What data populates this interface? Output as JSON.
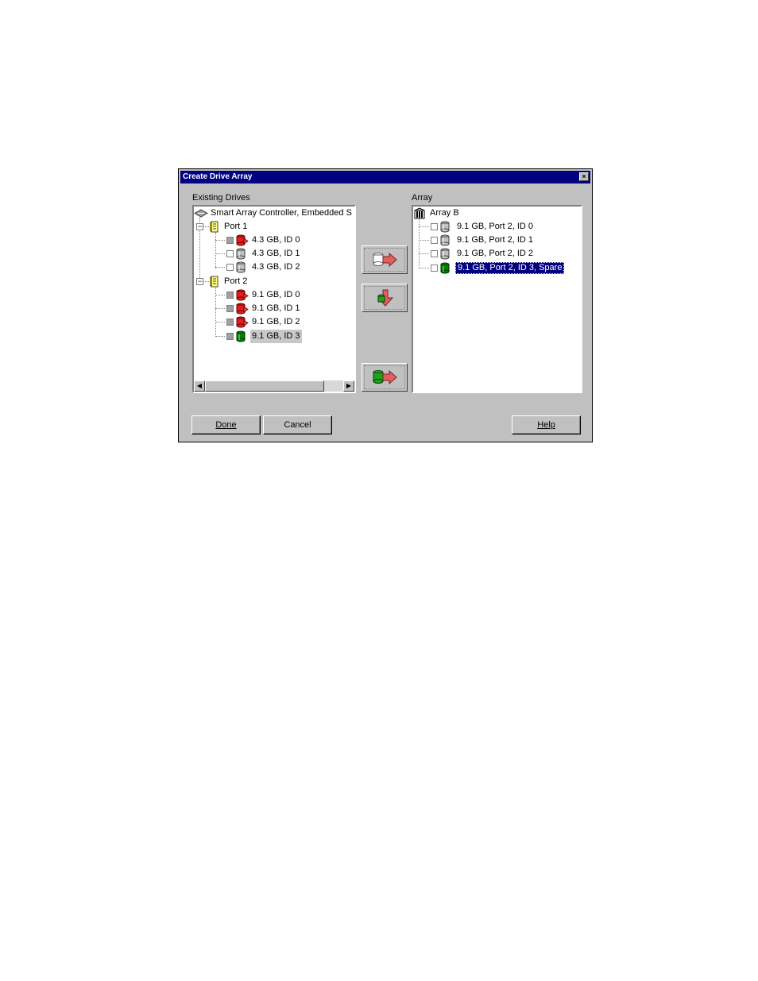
{
  "window": {
    "title": "Create Drive Array",
    "close_label": "×"
  },
  "existing": {
    "label": "Existing Drives",
    "controller": "Smart Array Controller, Embedded S",
    "ports": [
      {
        "label": "Port 1",
        "drives": [
          "4.3 GB, ID 0",
          "4.3 GB, ID 1",
          "4.3 GB, ID 2"
        ]
      },
      {
        "label": "Port 2",
        "drives": [
          "9.1 GB, ID 0",
          "9.1 GB, ID 1",
          "9.1 GB, ID 2",
          "9.1 GB, ID 3"
        ]
      }
    ]
  },
  "array": {
    "label": "Array",
    "name": "Array B",
    "drives": [
      "9.1 GB, Port 2, ID 0",
      "9.1 GB, Port 2, ID 1",
      "9.1 GB, Port 2, ID 2",
      "9.1 GB, Port 2, ID 3, Spare"
    ]
  },
  "buttons": {
    "done": "Done",
    "cancel": "Cancel",
    "help": "Help"
  },
  "icons": {
    "controller": "controller-icon",
    "port": "port-icon",
    "drive": "drive-icon",
    "drive_in_array": "drive-assigned-icon",
    "spare": "spare-drive-icon",
    "array": "array-icon"
  },
  "colors": {
    "title_bar": "#000080",
    "selection": "#000080",
    "assigned": "#e02020",
    "spare": "#008000"
  }
}
